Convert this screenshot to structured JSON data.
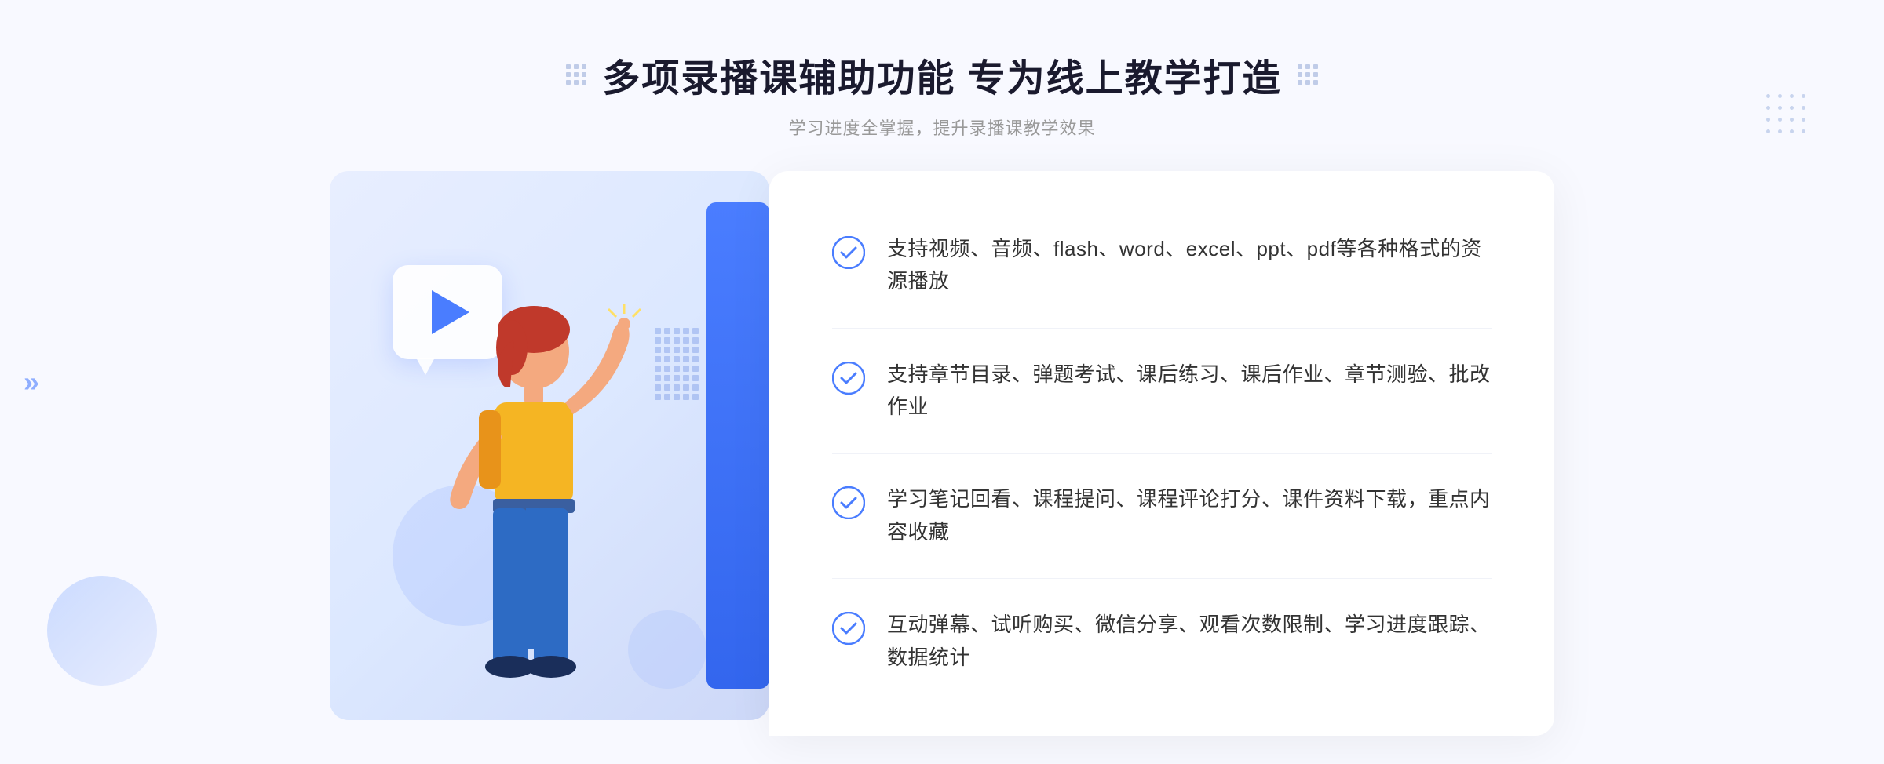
{
  "header": {
    "title": "多项录播课辅助功能 专为线上教学打造",
    "subtitle": "学习进度全掌握，提升录播课教学效果"
  },
  "features": [
    {
      "id": 1,
      "text": "支持视频、音频、flash、word、excel、ppt、pdf等各种格式的资源播放"
    },
    {
      "id": 2,
      "text": "支持章节目录、弹题考试、课后练习、课后作业、章节测验、批改作业"
    },
    {
      "id": 3,
      "text": "学习笔记回看、课程提问、课程评论打分、课件资料下载，重点内容收藏"
    },
    {
      "id": 4,
      "text": "互动弹幕、试听购买、微信分享、观看次数限制、学习进度跟踪、数据统计"
    }
  ],
  "icons": {
    "check": "check-circle-icon",
    "play": "play-icon",
    "grid": "grid-icon",
    "chevron": "»"
  },
  "colors": {
    "primary": "#4a7dff",
    "text_dark": "#1a1a2e",
    "text_gray": "#999999",
    "text_body": "#333333",
    "bg_light": "#f8f9ff",
    "white": "#ffffff"
  }
}
